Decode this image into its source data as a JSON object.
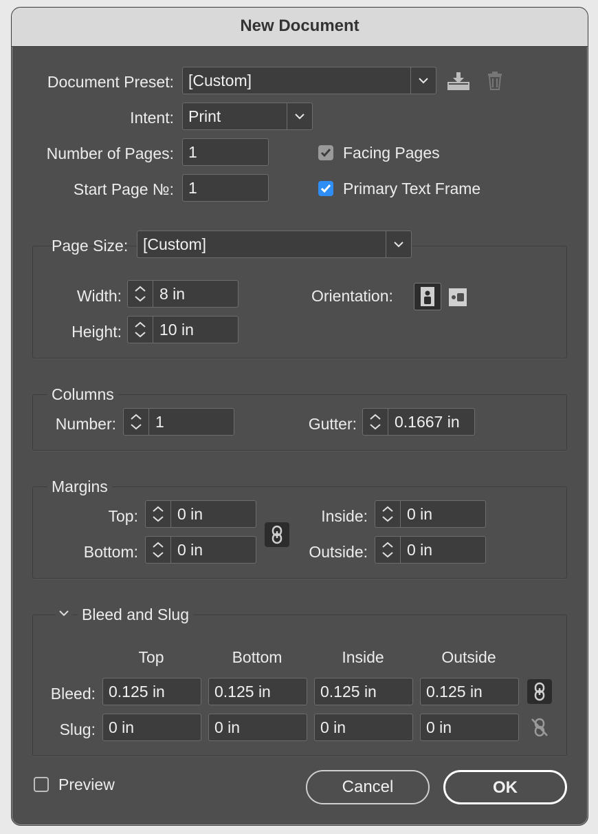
{
  "title": "New Document",
  "document_preset": {
    "label": "Document Preset:",
    "value": "[Custom]"
  },
  "intent": {
    "label": "Intent:",
    "value": "Print"
  },
  "number_of_pages": {
    "label": "Number of Pages:",
    "value": "1"
  },
  "start_page": {
    "label": "Start Page №:",
    "value": "1"
  },
  "facing_pages": {
    "label": "Facing Pages",
    "checked": true
  },
  "primary_text_frame": {
    "label": "Primary Text Frame",
    "checked": true
  },
  "page_size": {
    "label": "Page Size:",
    "value": "[Custom]",
    "width_label": "Width:",
    "width": "8 in",
    "height_label": "Height:",
    "height": "10 in",
    "orientation_label": "Orientation:",
    "orientation": "portrait"
  },
  "columns": {
    "title": "Columns",
    "number_label": "Number:",
    "number": "1",
    "gutter_label": "Gutter:",
    "gutter": "0.1667 in"
  },
  "margins": {
    "title": "Margins",
    "top_label": "Top:",
    "top": "0 in",
    "bottom_label": "Bottom:",
    "bottom": "0 in",
    "inside_label": "Inside:",
    "inside": "0 in",
    "outside_label": "Outside:",
    "outside": "0 in"
  },
  "bleed_slug": {
    "title": "Bleed and Slug",
    "headers": [
      "Top",
      "Bottom",
      "Inside",
      "Outside"
    ],
    "bleed_label": "Bleed:",
    "bleed": [
      "0.125 in",
      "0.125 in",
      "0.125 in",
      "0.125 in"
    ],
    "slug_label": "Slug:",
    "slug": [
      "0 in",
      "0 in",
      "0 in",
      "0 in"
    ]
  },
  "preview": {
    "label": "Preview",
    "checked": false
  },
  "buttons": {
    "cancel": "Cancel",
    "ok": "OK"
  },
  "colors": {
    "accent": "#2f8ef5",
    "panel": "#4e4e4e",
    "field": "#3d3d3d"
  }
}
